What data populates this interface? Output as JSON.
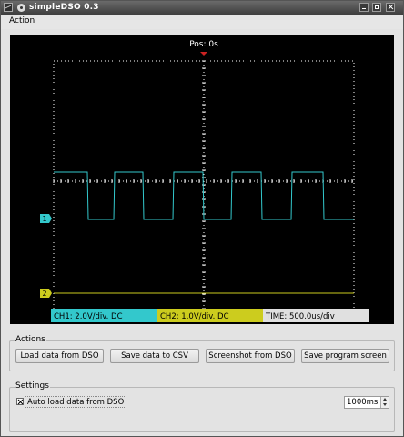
{
  "window": {
    "title": "simpleDSO 0.3"
  },
  "menu": {
    "items": [
      "Action"
    ]
  },
  "scope": {
    "position_label": "Pos: 0s",
    "channel_markers": {
      "ch1": "1",
      "ch2": "2"
    },
    "status": {
      "ch1": "CH1: 2.0V/div. DC",
      "ch2": "CH2: 1.0V/div. DC",
      "time": "TIME: 500.0us/div"
    },
    "colors": {
      "ch1": "#33c8cc",
      "ch2": "#cccc1e",
      "grid": "#ffffff",
      "trigger": "#cc2222",
      "background": "#000000"
    }
  },
  "actions": {
    "title": "Actions",
    "load_label": "Load data from DSO",
    "save_csv_label": "Save data to CSV",
    "screenshot_label": "Screenshot from DSO",
    "save_screen_label": "Save program screen"
  },
  "settings": {
    "title": "Settings",
    "autoload_label": "Auto load data from DSO",
    "autoload_checked": true,
    "interval_value": "1000ms"
  }
}
